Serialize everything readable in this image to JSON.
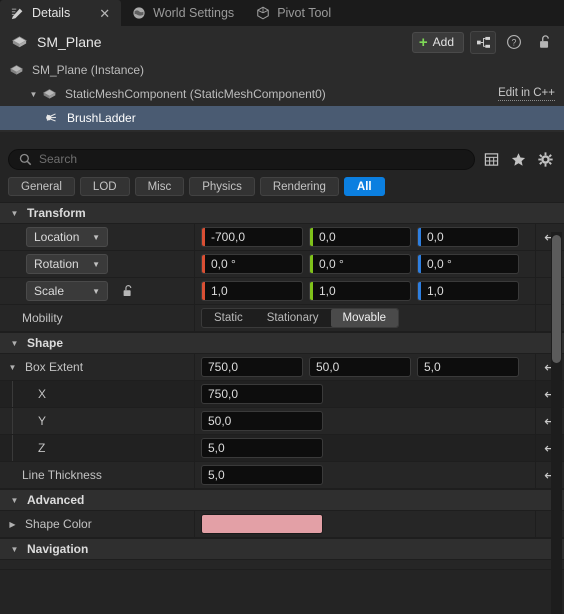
{
  "tabs": [
    {
      "label": "Details",
      "icon": "details-icon",
      "active": true,
      "closable": true,
      "close_glyph": "✕"
    },
    {
      "label": "World Settings",
      "icon": "globe-icon",
      "active": false,
      "closable": false
    },
    {
      "label": "Pivot Tool",
      "icon": "cube-icon",
      "active": false,
      "closable": false
    }
  ],
  "object_header": {
    "icon": "mesh-icon",
    "name": "SM_Plane",
    "add_button": "Add",
    "add_glyph": "+",
    "icons": [
      "blueprint-icon",
      "help-icon",
      "lock-open-icon"
    ]
  },
  "hierarchy": [
    {
      "label": "SM_Plane (Instance)",
      "icon": "mesh-icon",
      "indent": 0,
      "caret": "",
      "selected": false,
      "link": ""
    },
    {
      "label": "StaticMeshComponent (StaticMeshComponent0)",
      "icon": "mesh-icon",
      "indent": 1,
      "caret": "▼",
      "selected": false,
      "link": "Edit in C++"
    },
    {
      "label": "BrushLadder",
      "icon": "brush-icon",
      "indent": 2,
      "caret": "",
      "selected": true,
      "link": ""
    }
  ],
  "search": {
    "placeholder": "Search",
    "value": "",
    "icon": "search-icon",
    "trailing_icons": [
      "grid-view-icon",
      "favorites-star-icon",
      "settings-gear-icon"
    ]
  },
  "filters": [
    {
      "label": "General",
      "active": false
    },
    {
      "label": "LOD",
      "active": false
    },
    {
      "label": "Misc",
      "active": false
    },
    {
      "label": "Physics",
      "active": false
    },
    {
      "label": "Rendering",
      "active": false
    },
    {
      "label": "All",
      "active": true
    }
  ],
  "sections": {
    "transform": {
      "title": "Transform",
      "caret": "▼",
      "location": {
        "label": "Location",
        "x": "-700,0",
        "y": "0,0",
        "z": "0,0"
      },
      "rotation": {
        "label": "Rotation",
        "x": "0,0 °",
        "y": "0,0 °",
        "z": "0,0 °"
      },
      "scale": {
        "label": "Scale",
        "x": "1,0",
        "y": "1,0",
        "z": "1,0",
        "lock_icon": "lock-open-icon"
      },
      "mobility": {
        "label": "Mobility",
        "options": [
          "Static",
          "Stationary",
          "Movable"
        ],
        "selected": "Movable"
      }
    },
    "shape": {
      "title": "Shape",
      "caret": "▼",
      "box_extent": {
        "label": "Box Extent",
        "caret": "▼",
        "x": "750,0",
        "y": "50,0",
        "z": "5,0",
        "children": [
          {
            "label": "X",
            "value": "750,0"
          },
          {
            "label": "Y",
            "value": "50,0"
          },
          {
            "label": "Z",
            "value": "5,0"
          }
        ]
      },
      "line_thickness": {
        "label": "Line Thickness",
        "value": "5,0"
      }
    },
    "advanced": {
      "title": "Advanced",
      "caret": "▼",
      "shape_color": {
        "label": "Shape Color",
        "caret": "▶",
        "color": "#e3a0a6"
      }
    },
    "navigation": {
      "title": "Navigation",
      "caret": "▼"
    }
  },
  "colors": {
    "accent_x": "#d94f34",
    "accent_y": "#7fc21a",
    "accent_z": "#2e7fe0",
    "filter_active": "#0b7fe0",
    "selection": "#4a5b72",
    "add_plus": "#7ed957"
  },
  "reset_glyph": "↩"
}
